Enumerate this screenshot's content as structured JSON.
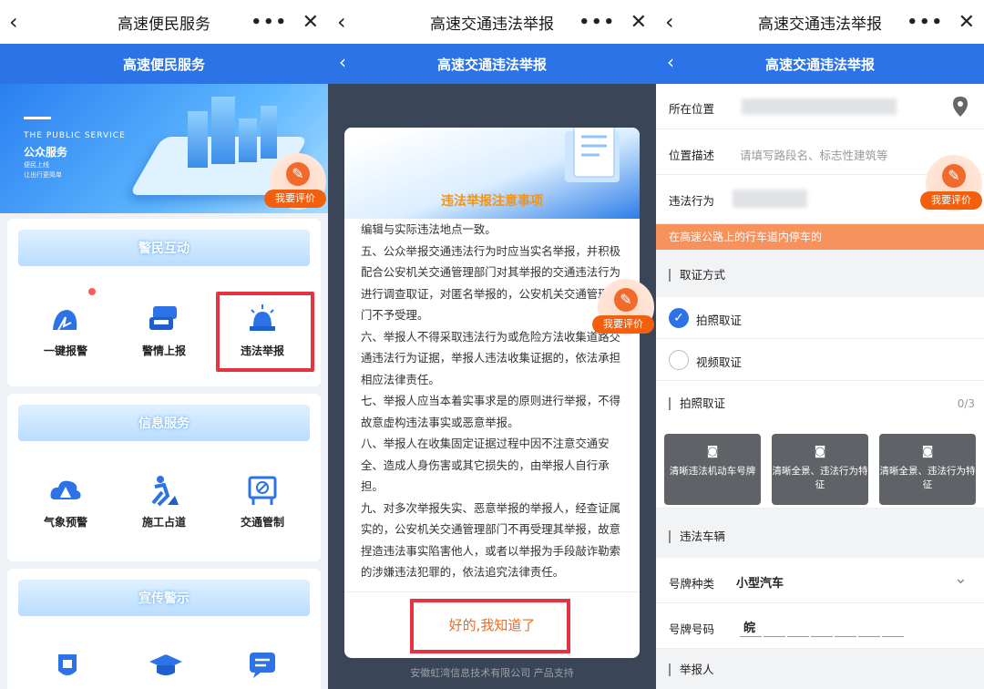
{
  "panel1": {
    "wx_title": "高速便民服务",
    "nav_title": "高速便民服务",
    "banner": {
      "en": "THE PUBLIC SERVICE",
      "cn": "公众服务",
      "slogan1": "便民上线",
      "slogan2": "让出行更简单"
    },
    "eval_label": "我要评价",
    "sections": [
      {
        "title": "警民互动",
        "items": [
          "一键报警",
          "警情上报",
          "违法举报"
        ]
      },
      {
        "title": "信息服务",
        "items": [
          "气象预警",
          "施工占道",
          "交通管制"
        ]
      },
      {
        "title": "宣传警示",
        "items": []
      }
    ]
  },
  "panel2": {
    "wx_title": "高速交通违法举报",
    "nav_title": "高速交通违法举报",
    "modal_title": "违法举报注意事项",
    "paragraphs": [
      "编辑与实际违法地点一致。",
      "五、公众举报交通违法行为时应当实名举报，并积极配合公安机关交通管理部门对其举报的交通违法行为进行调查取证，对匿名举报的，公安机关交通管理部门不予受理。",
      "六、举报人不得采取违法行为或危险方法收集道路交通违法行为证据，举报人违法收集证据的，依法承担相应法律责任。",
      "七、举报人应当本着实事求是的原则进行举报，不得故意虚构违法事实或恶意举报。",
      "八、举报人在收集固定证据过程中因不注意交通安全、造成人身伤害或其它损失的，由举报人自行承担。",
      "九、对多次举报失实、恶意举报的举报人，经查证属实的，公安机关交通管理部门不再受理其举报，故意捏造违法事实陷害他人，或者以举报为手段敲诈勒索的涉嫌违法犯罪的，依法追究法律责任。"
    ],
    "ok_button": "好的,我知道了",
    "eval_label": "我要评价",
    "footer": "安徽虹湾信息技术有限公司 产品支持"
  },
  "panel3": {
    "wx_title": "高速交通违法举报",
    "nav_title": "高速交通违法举报",
    "location_label": "所在位置",
    "desc_label": "位置描述",
    "desc_placeholder": "请填写路段名、标志性建筑等",
    "behavior_label": "违法行为",
    "behavior_value": "在高速公路上的行车道内停车的",
    "eval_label": "我要评价",
    "evidence_title": "取证方式",
    "opt_photo": "拍照取证",
    "opt_video": "视频取证",
    "photo_title": "拍照取证",
    "photo_count": "0/3",
    "photo_slots": [
      "清晰违法机动车号牌",
      "清晰全景、违法行为特征",
      "清晰全景、违法行为特征"
    ],
    "vehicle_title": "违法车辆",
    "plate_type_label": "号牌种类",
    "plate_type_value": "小型汽车",
    "plate_no_label": "号牌号码",
    "plate_no_prefix": "皖",
    "reporter_title": "举报人"
  },
  "colors": {
    "nav_blue": "#2b73e6",
    "orange": "#f8925d",
    "alert_red": "#e53340"
  }
}
